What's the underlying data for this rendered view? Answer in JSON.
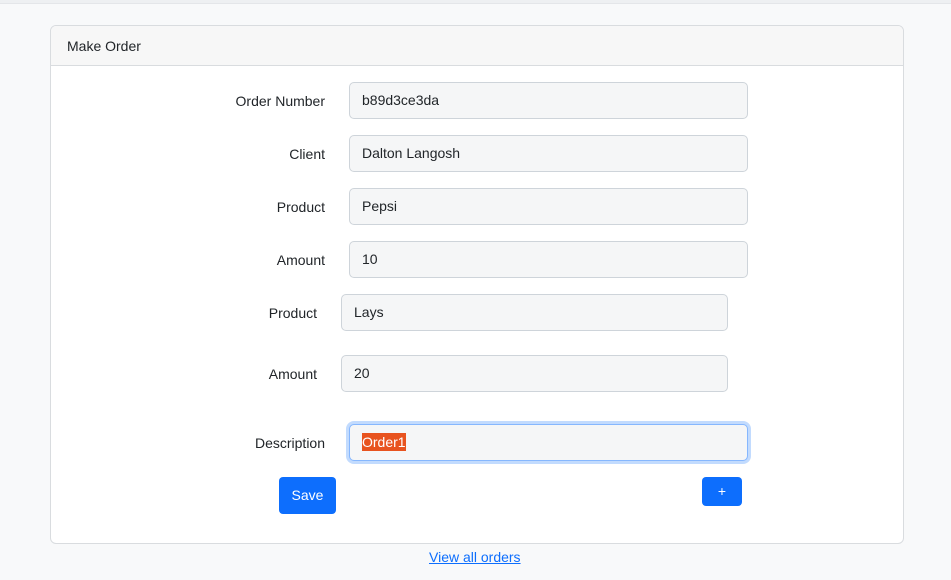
{
  "card": {
    "title": "Make Order"
  },
  "form": {
    "order_number": {
      "label": "Order Number",
      "value": "b89d3ce3da"
    },
    "client": {
      "label": "Client",
      "value": "Dalton Langosh"
    },
    "items": [
      {
        "product_label": "Product",
        "product_value": "Pepsi",
        "amount_label": "Amount",
        "amount_value": "10"
      },
      {
        "product_label": "Product",
        "product_value": "Lays",
        "amount_label": "Amount",
        "amount_value": "20"
      }
    ],
    "description": {
      "label": "Description",
      "value": "Order1"
    },
    "save_label": "Save",
    "add_label": "+"
  },
  "footer": {
    "view_all_link": "View all orders"
  },
  "colors": {
    "primary": "#0d6efd",
    "selection": "#e8531f",
    "page_bg": "#f8f9fa"
  }
}
